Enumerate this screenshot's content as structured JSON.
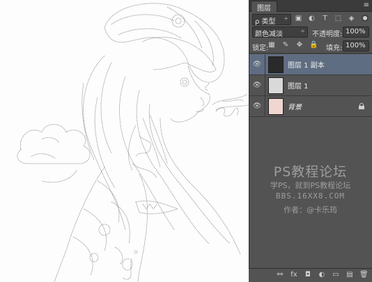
{
  "panel": {
    "tab_label": "图层",
    "menu_glyph": "≡"
  },
  "filter": {
    "kind_label": "ρ 类型",
    "caret": "÷"
  },
  "blend": {
    "mode_label": "颜色减淡",
    "caret": "÷",
    "opacity_label": "不透明度:",
    "opacity_value": "100%"
  },
  "lock": {
    "label": "锁定:",
    "fill_label": "填充:",
    "fill_value": "100%"
  },
  "layers": [
    {
      "name": "图层 1 副本",
      "selected": true
    },
    {
      "name": "图层 1",
      "selected": false
    },
    {
      "name": "背景",
      "selected": false,
      "locked": true
    }
  ],
  "watermark": {
    "line1": "PS教程论坛",
    "line2": "学PS，就到PS教程论坛",
    "line3": "BBS.16XX8.COM",
    "line4": "作者：@卡乐筠"
  },
  "icons": {
    "eye": "👁",
    "filter": [
      "▣",
      "◐",
      "T",
      "⬚",
      "◈"
    ],
    "lock": [
      "▦",
      "✎",
      "✥",
      "🔒"
    ],
    "bottom": [
      "⚯",
      "fx",
      "◘",
      "◐",
      "▭",
      "▤",
      "🗑"
    ]
  },
  "colors": {
    "panel_bg": "#535353",
    "selected_layer": "#5f6d82",
    "canvas_bg": "#fdfdfd",
    "watermark": "#9d9d9d"
  }
}
